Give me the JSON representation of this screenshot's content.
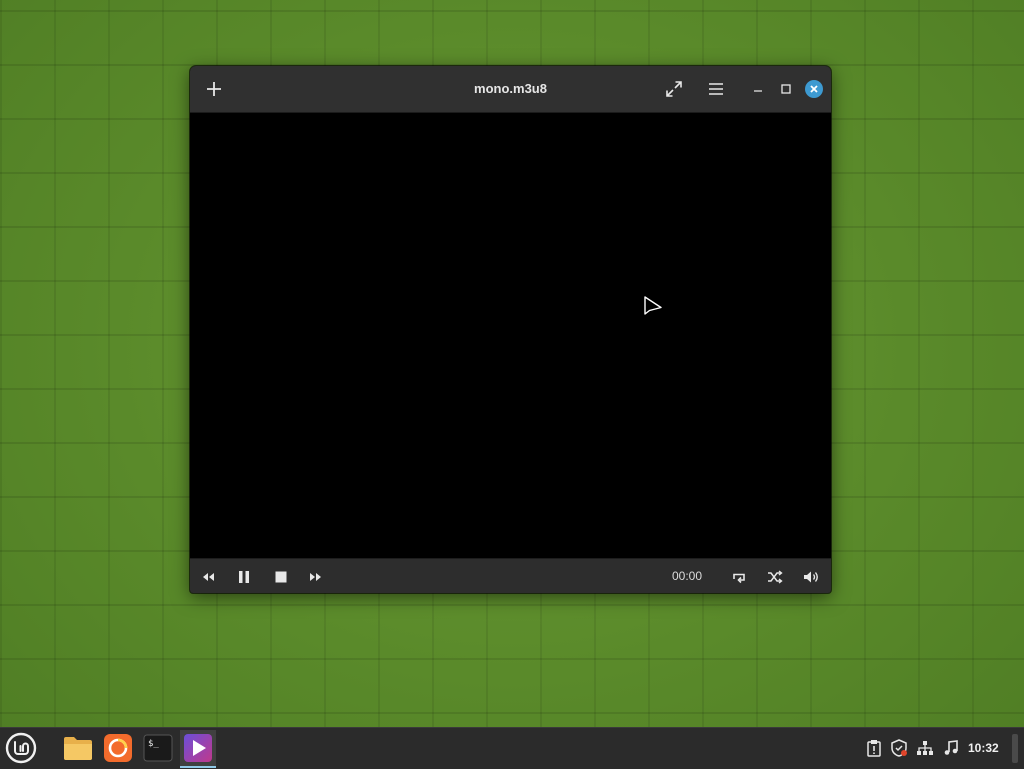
{
  "window": {
    "title": "mono.m3u8",
    "icons": {
      "add": "plus-icon",
      "fullscreen": "fullscreen-icon",
      "menu": "hamburger-menu-icon",
      "minimize": "minimize-icon",
      "maximize": "maximize-icon",
      "close": "close-icon"
    }
  },
  "controls": {
    "time": "00:00",
    "icons": [
      "rewind-icon",
      "pause-icon",
      "stop-icon",
      "fast-forward-icon",
      "repeat-icon",
      "shuffle-icon",
      "volume-icon"
    ]
  },
  "taskbar": {
    "launchers": [
      "linux-mint-menu-icon",
      "files-folder-icon",
      "firefox-icon",
      "terminal-icon",
      "media-player-icon"
    ],
    "terminal_glyph": "$_",
    "tray": [
      "clipboard-icon",
      "update-shield-icon",
      "network-icon",
      "sound-icon"
    ],
    "clock": "10:32"
  },
  "colors": {
    "desktop": "#5b8a2b",
    "titlebar": "#303030",
    "controlbar": "#2d2d2d",
    "close_accent": "#3d9ad1",
    "taskbar": "#2b2b2b"
  }
}
